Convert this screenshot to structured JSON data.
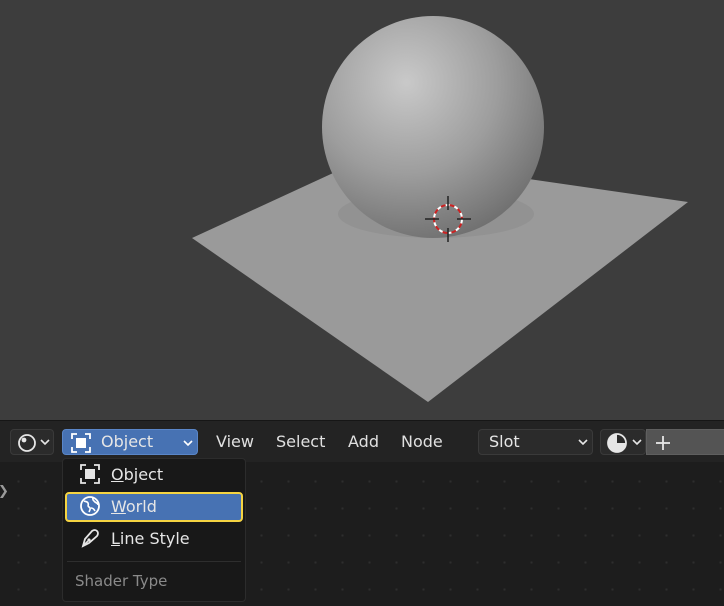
{
  "header": {
    "shader_type": "Object",
    "menus": [
      "View",
      "Select",
      "Add",
      "Node"
    ],
    "slot": "Slot",
    "new_icon": "plus-icon"
  },
  "dropdown": {
    "items": [
      {
        "label": "Object",
        "underline": "O",
        "rest": "bject",
        "icon": "object-icon",
        "active": false
      },
      {
        "label": "World",
        "underline": "W",
        "rest": "orld",
        "icon": "world-icon",
        "active": true
      },
      {
        "label": "Line Style",
        "underline": "L",
        "rest": "ine Style",
        "icon": "line-style-icon",
        "active": false
      }
    ],
    "header": "Shader Type"
  },
  "colors": {
    "accent": "#4772b3",
    "highlight_outline": "#f5d442",
    "viewport_bg": "#3d3d3d"
  }
}
